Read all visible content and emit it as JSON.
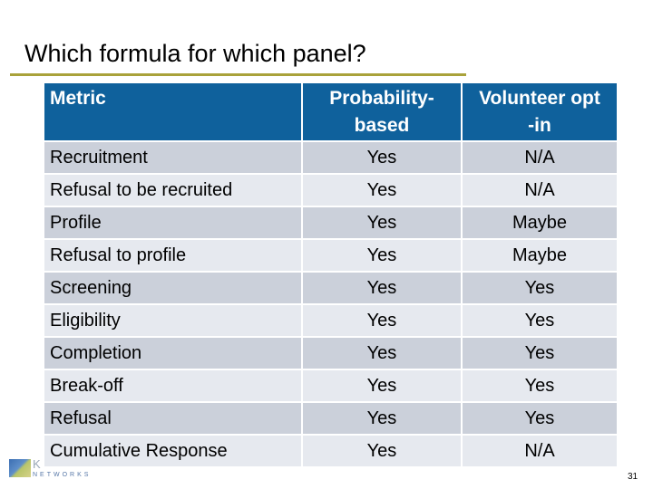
{
  "slide": {
    "title": "Which formula for which panel?",
    "accent_color": "#a9a23a",
    "header_color": "#0f619c",
    "page_number": "31"
  },
  "logo": {
    "letter": "K",
    "subtext": "NETWORKS"
  },
  "table": {
    "headers": [
      "Metric",
      "Probability-based",
      "Volunteer opt-in"
    ],
    "header_lines": {
      "metric": "Metric",
      "prob": "Probability-\nbased",
      "vol": "Volunteer opt\n-in"
    },
    "rows": [
      {
        "metric": "Recruitment",
        "prob": "Yes",
        "vol": "N/A"
      },
      {
        "metric": "Refusal to be recruited",
        "prob": "Yes",
        "vol": "N/A"
      },
      {
        "metric": "Profile",
        "prob": "Yes",
        "vol": "Maybe"
      },
      {
        "metric": "Refusal to profile",
        "prob": "Yes",
        "vol": "Maybe"
      },
      {
        "metric": "Screening",
        "prob": "Yes",
        "vol": "Yes"
      },
      {
        "metric": "Eligibility",
        "prob": "Yes",
        "vol": "Yes"
      },
      {
        "metric": "Completion",
        "prob": "Yes",
        "vol": "Yes"
      },
      {
        "metric": "Break-off",
        "prob": "Yes",
        "vol": "Yes"
      },
      {
        "metric": "Refusal",
        "prob": "Yes",
        "vol": "Yes"
      },
      {
        "metric": "Cumulative Response",
        "prob": "Yes",
        "vol": "N/A"
      }
    ]
  }
}
